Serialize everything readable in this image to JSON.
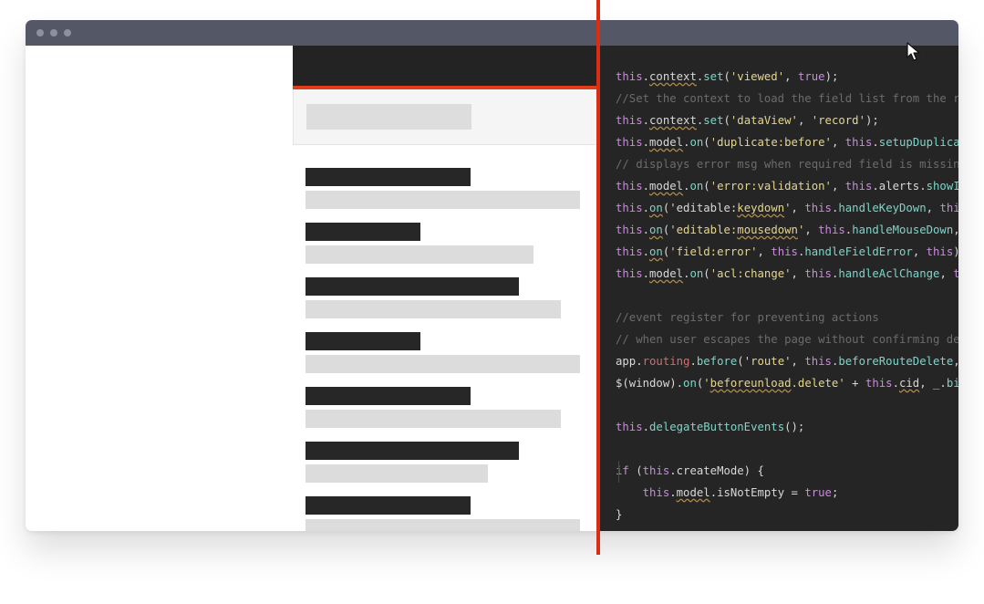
{
  "colors": {
    "titlebar": "#545765",
    "app_header": "#232323",
    "accent_divider": "#d92d14",
    "code_bg": "#252526",
    "keyword": "#cc88e0",
    "method": "#79d7c9",
    "string": "#e6d68a",
    "comment": "#6c6c6c"
  },
  "window": {
    "controls": [
      "close-dot",
      "minimize-dot",
      "maximize-dot"
    ]
  },
  "code": {
    "lines": [
      [
        {
          "t": "this",
          "c": "k"
        },
        {
          "t": "."
        },
        {
          "t": "context",
          "q": 1
        },
        {
          "t": "."
        },
        {
          "t": "set",
          "c": "m"
        },
        {
          "t": "("
        },
        {
          "t": "'viewed'",
          "c": "s"
        },
        {
          "t": ", "
        },
        {
          "t": "true",
          "c": "k"
        },
        {
          "t": ");"
        }
      ],
      [
        {
          "t": "//Set the context to load the field list from the reco",
          "c": "c"
        }
      ],
      [
        {
          "t": "this",
          "c": "k"
        },
        {
          "t": "."
        },
        {
          "t": "context",
          "q": 1
        },
        {
          "t": "."
        },
        {
          "t": "set",
          "c": "m"
        },
        {
          "t": "("
        },
        {
          "t": "'dataView'",
          "c": "s"
        },
        {
          "t": ", "
        },
        {
          "t": "'record'",
          "c": "s"
        },
        {
          "t": ");"
        }
      ],
      [
        {
          "t": "this",
          "c": "k"
        },
        {
          "t": "."
        },
        {
          "t": "model",
          "q": 1
        },
        {
          "t": "."
        },
        {
          "t": "on",
          "c": "m"
        },
        {
          "t": "("
        },
        {
          "t": "'duplicate:before'",
          "c": "s"
        },
        {
          "t": ", "
        },
        {
          "t": "this",
          "c": "k"
        },
        {
          "t": "."
        },
        {
          "t": "setupDuplicateF",
          "c": "m"
        }
      ],
      [
        {
          "t": "// displays error msg when required field is missing",
          "c": "c"
        }
      ],
      [
        {
          "t": "this",
          "c": "k"
        },
        {
          "t": "."
        },
        {
          "t": "model",
          "q": 1
        },
        {
          "t": "."
        },
        {
          "t": "on",
          "c": "m"
        },
        {
          "t": "("
        },
        {
          "t": "'error:validation'",
          "c": "s"
        },
        {
          "t": ", "
        },
        {
          "t": "this",
          "c": "k"
        },
        {
          "t": ".alerts."
        },
        {
          "t": "showInva",
          "c": "m"
        }
      ],
      [
        {
          "t": "this",
          "c": "k"
        },
        {
          "t": "."
        },
        {
          "t": "on",
          "q": 1,
          "c": "m"
        },
        {
          "t": "("
        },
        {
          "t": "'editable:"
        },
        {
          "t": "keydown",
          "q": 1,
          "c": "s"
        },
        {
          "t": "'",
          "c": "s"
        },
        {
          "t": ", "
        },
        {
          "t": "this",
          "c": "k"
        },
        {
          "t": "."
        },
        {
          "t": "handleKeyDown",
          "c": "m"
        },
        {
          "t": ", "
        },
        {
          "t": "this",
          "c": "k"
        },
        {
          "t": ");"
        }
      ],
      [
        {
          "t": "this",
          "c": "k"
        },
        {
          "t": "."
        },
        {
          "t": "on",
          "q": 1,
          "c": "m"
        },
        {
          "t": "("
        },
        {
          "t": "'editable:",
          "c": "s"
        },
        {
          "t": "mousedown",
          "q": 1,
          "c": "s"
        },
        {
          "t": "'",
          "c": "s"
        },
        {
          "t": ", "
        },
        {
          "t": "this",
          "c": "k"
        },
        {
          "t": "."
        },
        {
          "t": "handleMouseDown",
          "c": "m"
        },
        {
          "t": ", "
        },
        {
          "t": "th",
          "c": "k"
        }
      ],
      [
        {
          "t": "this",
          "c": "k"
        },
        {
          "t": "."
        },
        {
          "t": "on",
          "q": 1,
          "c": "m"
        },
        {
          "t": "("
        },
        {
          "t": "'field:error'",
          "c": "s"
        },
        {
          "t": ", "
        },
        {
          "t": "this",
          "c": "k"
        },
        {
          "t": "."
        },
        {
          "t": "handleFieldError",
          "c": "m"
        },
        {
          "t": ", "
        },
        {
          "t": "this",
          "c": "k"
        },
        {
          "t": ");"
        }
      ],
      [
        {
          "t": "this",
          "c": "k"
        },
        {
          "t": "."
        },
        {
          "t": "model",
          "q": 1
        },
        {
          "t": "."
        },
        {
          "t": "on",
          "c": "m"
        },
        {
          "t": "("
        },
        {
          "t": "'acl:change'",
          "c": "s"
        },
        {
          "t": ", "
        },
        {
          "t": "this",
          "c": "k"
        },
        {
          "t": "."
        },
        {
          "t": "handleAclChange",
          "c": "m"
        },
        {
          "t": ", "
        },
        {
          "t": "this",
          "c": "k"
        }
      ],
      [],
      [
        {
          "t": "//event register for preventing actions",
          "c": "c"
        }
      ],
      [
        {
          "t": "// when user escapes the page without confirming delet",
          "c": "c"
        }
      ],
      [
        {
          "t": "app"
        },
        {
          "t": "."
        },
        {
          "t": "routing",
          "c": "o"
        },
        {
          "t": "."
        },
        {
          "t": "before",
          "c": "m"
        },
        {
          "t": "("
        },
        {
          "t": "'route'",
          "c": "s"
        },
        {
          "t": ", "
        },
        {
          "t": "this",
          "c": "k"
        },
        {
          "t": "."
        },
        {
          "t": "beforeRouteDelete",
          "c": "m"
        },
        {
          "t": ", "
        },
        {
          "t": "th",
          "c": "k"
        }
      ],
      [
        {
          "t": "$(window)."
        },
        {
          "t": "on",
          "c": "m"
        },
        {
          "t": "("
        },
        {
          "t": "'",
          "c": "s"
        },
        {
          "t": "beforeunload",
          "q": 1,
          "c": "s"
        },
        {
          "t": ".delete'",
          "c": "s"
        },
        {
          "t": " + "
        },
        {
          "t": "this",
          "c": "k"
        },
        {
          "t": "."
        },
        {
          "t": "cid",
          "q": 1
        },
        {
          "t": ", _."
        },
        {
          "t": "bind",
          "c": "m"
        },
        {
          "t": "("
        }
      ],
      [],
      [
        {
          "t": "this",
          "c": "k"
        },
        {
          "t": "."
        },
        {
          "t": "delegateButtonEvents",
          "c": "m"
        },
        {
          "t": "();"
        }
      ],
      [],
      [
        {
          "t": "if",
          "c": "k"
        },
        {
          "t": " ("
        },
        {
          "t": "this",
          "c": "k"
        },
        {
          "t": ".createMode) {"
        }
      ],
      [
        {
          "t": "    "
        },
        {
          "t": "this",
          "c": "k"
        },
        {
          "t": "."
        },
        {
          "t": "model",
          "q": 1
        },
        {
          "t": ".isNotEmpty = "
        },
        {
          "t": "true",
          "c": "k"
        },
        {
          "t": ";"
        }
      ],
      [
        {
          "t": "}"
        }
      ]
    ]
  }
}
